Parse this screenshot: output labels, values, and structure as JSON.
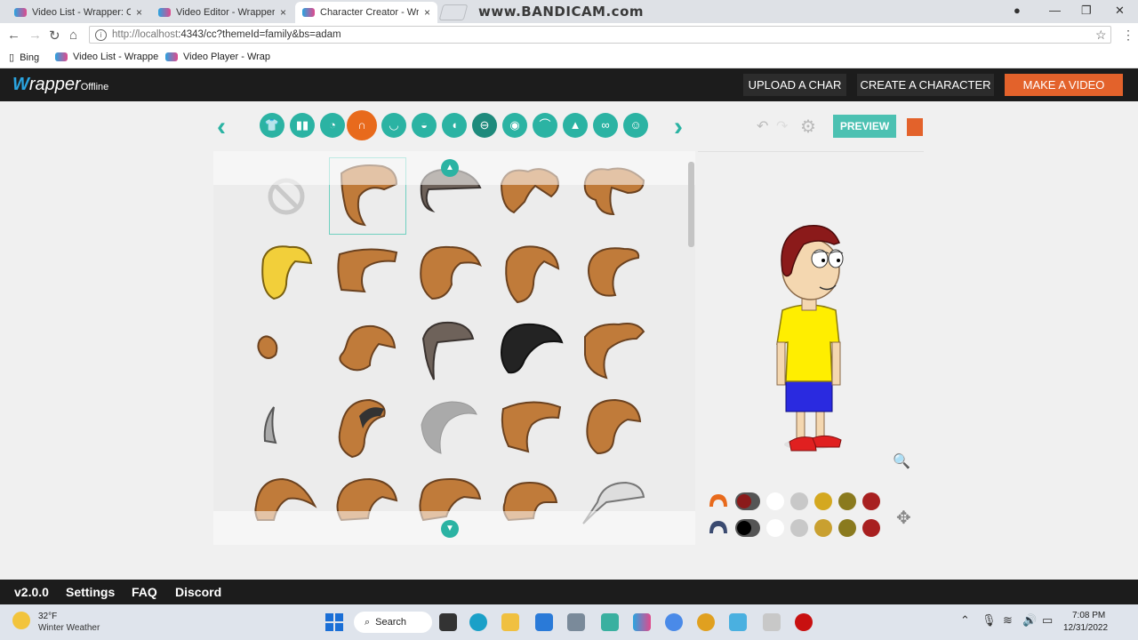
{
  "browser": {
    "tabs": [
      {
        "title": "Video List - Wrapper: Off",
        "close": "×"
      },
      {
        "title": "Video Editor - Wrapper: O",
        "close": "×"
      },
      {
        "title": "Character Creator - Wrap",
        "close": "×"
      }
    ],
    "watermark": "www.BANDICAM.com",
    "url_host": "http://localhost",
    "url_rest": ":4343/cc?themeId=family&bs=adam",
    "bookmarks": [
      "Bing",
      "Video List - Wrappe",
      "Video Player - Wrap"
    ]
  },
  "app": {
    "logo_main": "rapper",
    "logo_w": "W",
    "logo_sub": "Offline",
    "header_buttons": {
      "upload": "UPLOAD A CHAR",
      "create": "CREATE A CHARACTER",
      "make_video": "MAKE A VIDEO"
    },
    "categories": [
      "shirt-icon",
      "pants-icon",
      "face-icon",
      "hair-icon",
      "head-icon",
      "mouth-icon",
      "ear-icon",
      "glasses-frame-icon",
      "eye-icon",
      "eyebrow-icon",
      "nose-icon",
      "glasses-icon",
      "mustache-icon"
    ],
    "selected_category": "hair-icon",
    "preview_label": "PREVIEW",
    "colors": {
      "accent": "#2bb3a3",
      "orange": "#e3622b",
      "hair_brown": "#c07b3a",
      "shirt_yellow": "#ffee00",
      "shorts_blue": "#2a2ae0"
    },
    "swatch_rows": [
      {
        "selected": "#8b1a1a",
        "options": [
          "#ffffff",
          "#c8c8c8",
          "#d4a820",
          "#8a7a1e",
          "#a82020"
        ]
      },
      {
        "selected": "#000000",
        "options": [
          "#ffffff",
          "#c8c8c8",
          "#c9a030",
          "#8a7a1e",
          "#a82020"
        ]
      }
    ]
  },
  "footer": {
    "version": "v2.0.0",
    "settings": "Settings",
    "faq": "FAQ",
    "discord": "Discord"
  },
  "taskbar": {
    "temp": "32°F",
    "weather": "Winter Weather",
    "search": "Search",
    "time": "7:08 PM",
    "date": "12/31/2022"
  }
}
